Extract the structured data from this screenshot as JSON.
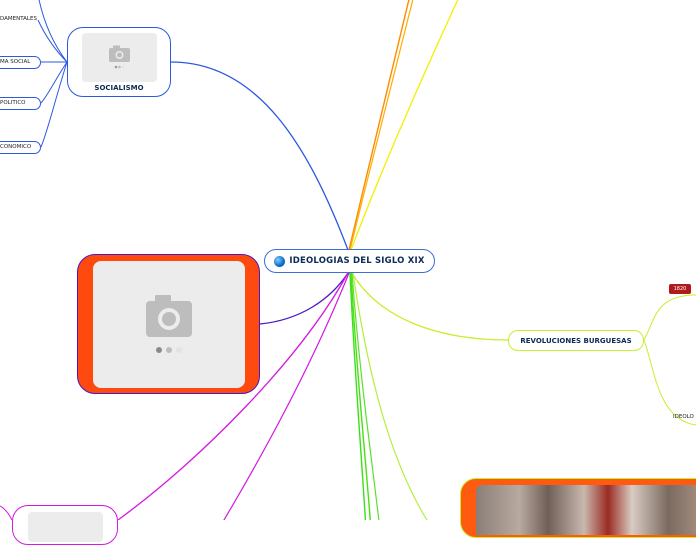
{
  "central": {
    "title": "IDEOLOGIAS DEL SIGLO XIX"
  },
  "socialismo": {
    "label": "SOCIALISMO",
    "leaves": [
      "DAMENTALES",
      "MA SOCIAL",
      "POLITICO",
      "CONOMICO"
    ]
  },
  "revoluciones": {
    "label": "REVOLUCIONES BURGUESAS",
    "badge": "1820",
    "sub": "IDEOLO"
  },
  "colors": {
    "socialismo_branch": "#2b59e0",
    "image_branch": "#4a18c4",
    "revol_branch": "#c6ef2d",
    "magenta_branch": "#d21ae0",
    "green_branch": "#39e01a",
    "orange_branch": "#ff8a00",
    "yellow_branch": "#f2f000",
    "image_fill": "#ff4a0f",
    "badge": "#b01a1a"
  },
  "icons": [
    "globe-icon",
    "camera-icon"
  ]
}
